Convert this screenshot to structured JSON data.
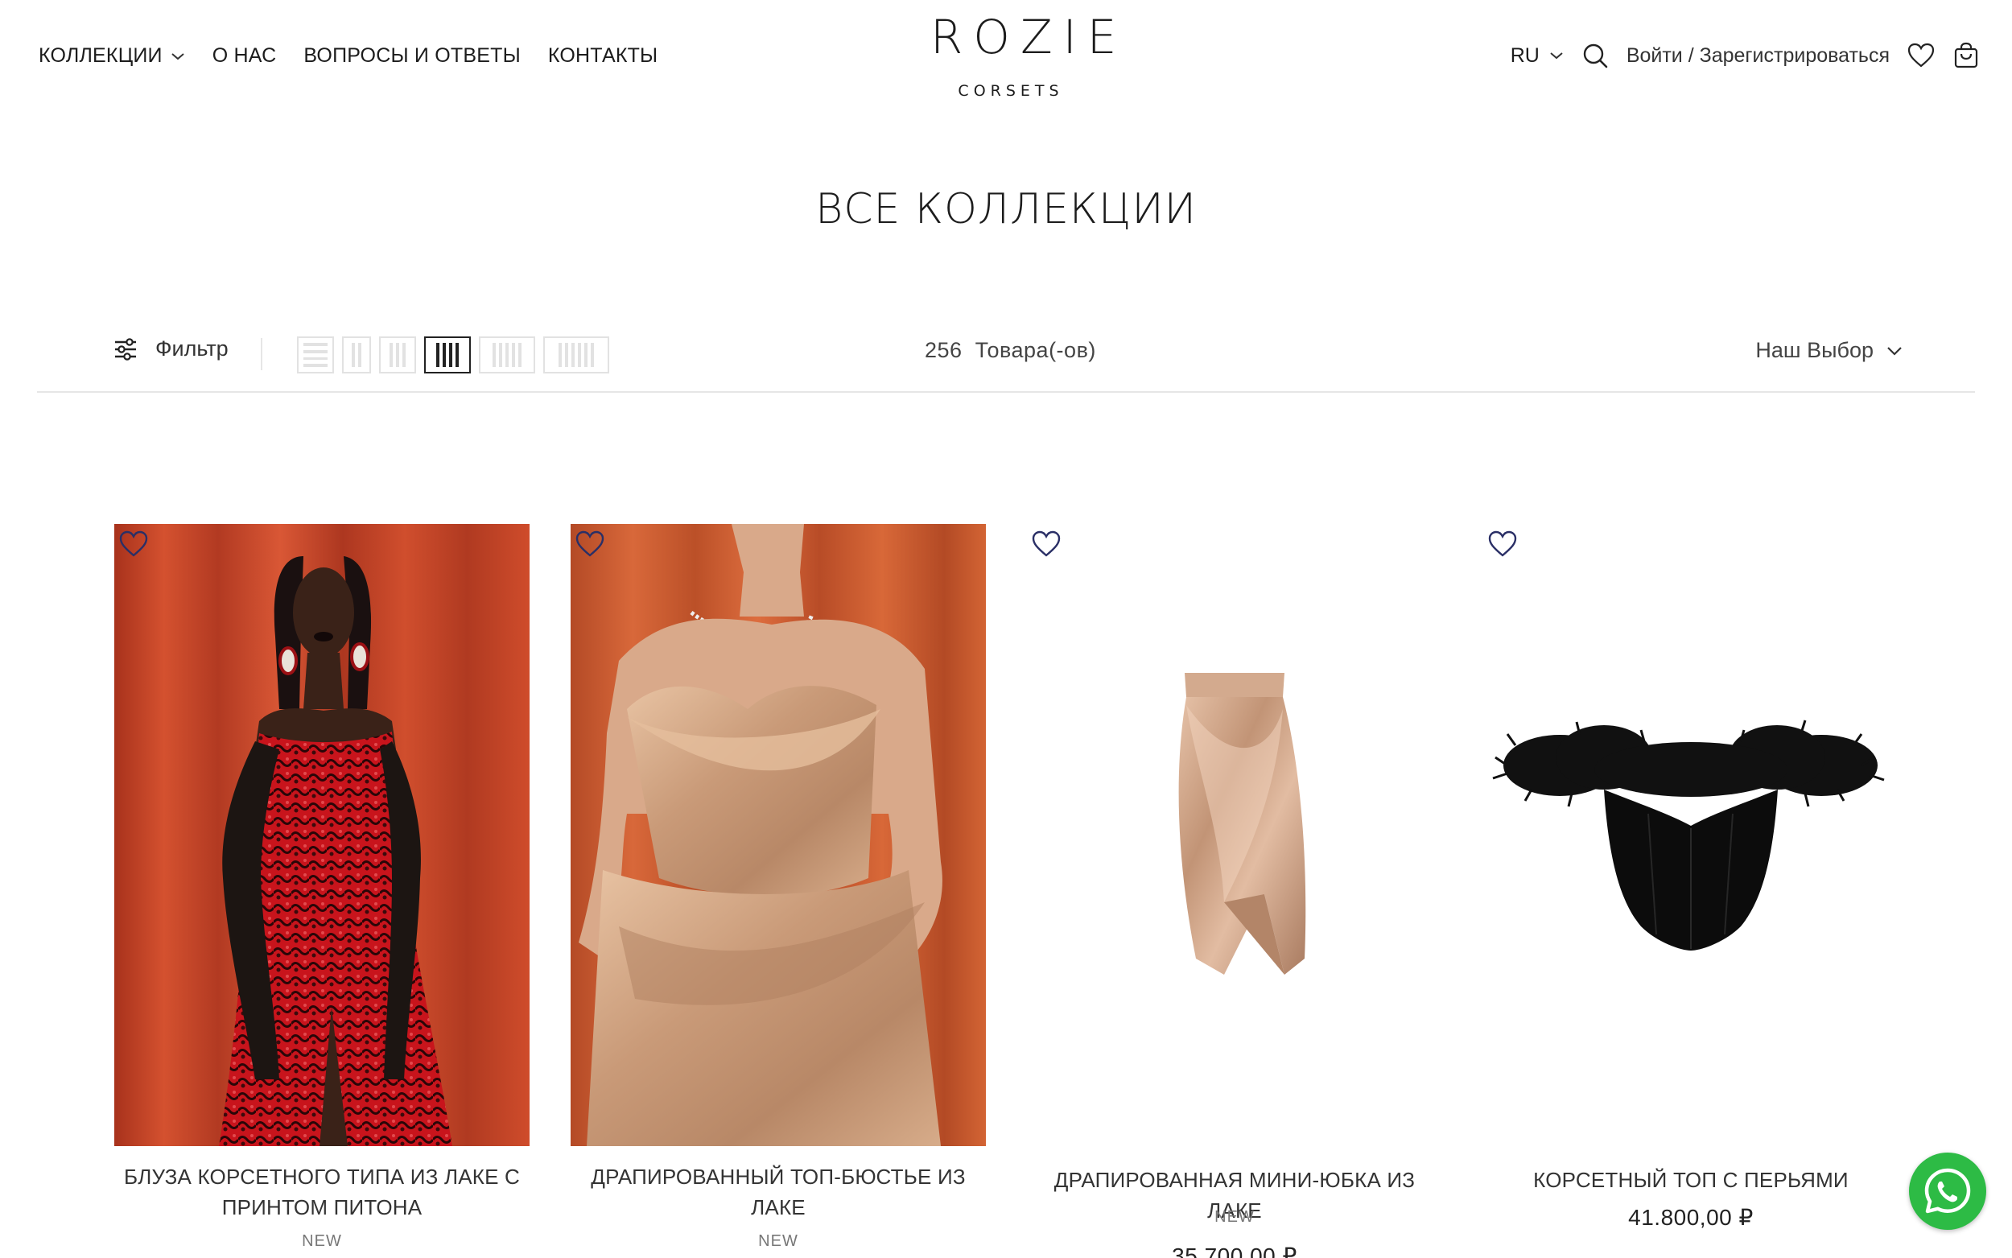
{
  "header": {
    "nav": {
      "collections": "КОЛЛЕКЦИИ",
      "about": "О НАС",
      "faq": "ВОПРОСЫ И ОТВЕТЫ",
      "contacts": "КОНТАКТЫ"
    },
    "logo": {
      "main": "ROZIE",
      "sub": "CORSETS"
    },
    "lang": "RU",
    "login": "Войти / Зарегистрироваться"
  },
  "page_title": "ВСЕ КОЛЛЕКЦИИ",
  "toolbar": {
    "filter_label": "Фильтр",
    "count_number": "256",
    "count_unit": "Товара(-ов)",
    "sort_label": "Наш Выбор",
    "grid_options": [
      "list",
      "2",
      "3",
      "4",
      "5",
      "6"
    ],
    "grid_active": "4"
  },
  "products": [
    {
      "name": "БЛУЗА КОРСЕТНОГО ТИПА ИЗ ЛАКЕ С ПРИНТОМ ПИТОНА",
      "tag": "NEW",
      "price": ""
    },
    {
      "name": "ДРАПИРОВАННЫЙ ТОП-БЮСТЬЕ ИЗ ЛАКЕ",
      "tag": "NEW",
      "price": ""
    },
    {
      "name": "ДРАПИРОВАННАЯ МИНИ-ЮБКА ИЗ ЛАКЕ",
      "tag": "NEW",
      "price": "35.700,00 ₽"
    },
    {
      "name": "КОРСЕТНЫЙ ТОП С ПЕРЬЯМИ",
      "tag": "",
      "price": "41.800,00 ₽"
    }
  ],
  "colors": {
    "text": "#1c1c1c",
    "border": "#e6e6e6",
    "heart": "#2a2f66",
    "whatsapp": "#2dbb45",
    "curtain": "#c0452a"
  },
  "icons": [
    "chevron-down-icon",
    "search-icon",
    "heart-icon",
    "cart-icon",
    "filter-sliders-icon",
    "whatsapp-icon"
  ]
}
